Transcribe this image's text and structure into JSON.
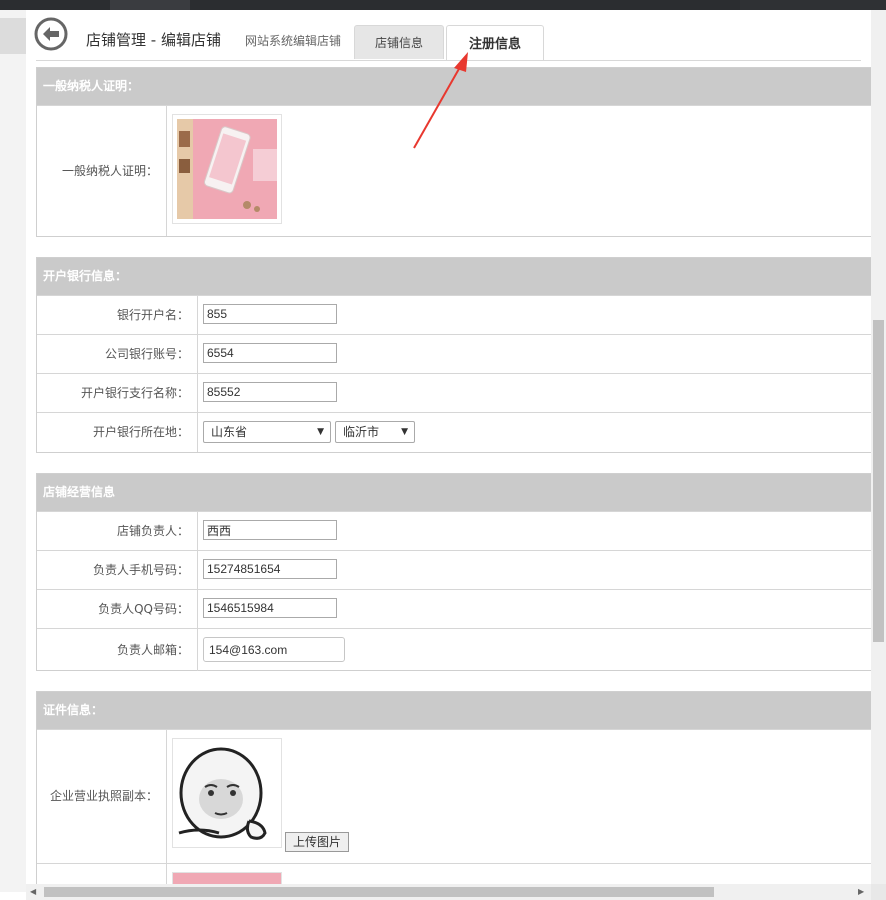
{
  "header": {
    "title": "店铺管理 - 编辑店铺",
    "subtitle": "网站系统编辑店铺",
    "tabs": [
      {
        "label": "店铺信息",
        "active": false
      },
      {
        "label": "注册信息",
        "active": true
      }
    ]
  },
  "taxpayer": {
    "heading": "一般纳税人证明：",
    "field_label": "一般纳税人证明："
  },
  "bank": {
    "heading": "开户银行信息：",
    "account_name_label": "银行开户名：",
    "account_name_value": "855",
    "account_number_label": "公司银行账号：",
    "account_number_value": "6554",
    "branch_label": "开户银行支行名称：",
    "branch_value": "85552",
    "location_label": "开户银行所在地：",
    "province": "山东省",
    "city": "临沂市"
  },
  "operation": {
    "heading": "店铺经营信息",
    "manager_label": "店铺负责人：",
    "manager_value": "西西",
    "phone_label": "负责人手机号码：",
    "phone_value": "15274851654",
    "qq_label": "负责人QQ号码：",
    "qq_value": "1546515984",
    "email_label": "负责人邮箱：",
    "email_value": "154@163.com"
  },
  "certificates": {
    "heading": "证件信息：",
    "license_label": "企业营业执照副本：",
    "upload_label": "上传图片"
  },
  "colors": {
    "accent_arrow": "#e8382f",
    "section_header": "#cacaca"
  }
}
